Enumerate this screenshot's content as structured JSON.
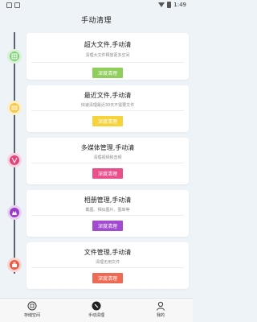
{
  "status_bar": {
    "time": "1:49"
  },
  "page_title": "手动清理",
  "items": [
    {
      "title": "超大文件,手动清",
      "subtitle": "清理大文件释放更多空间",
      "button": "深度清理",
      "button_color": "#8fce5a",
      "dot_color": "#7fcf7a",
      "icon": "grid-icon"
    },
    {
      "title": "最近文件,手动清",
      "subtitle": "快速清理最近30天不需要文件",
      "button": "深度清理",
      "button_color": "#f6d23b",
      "dot_color": "#f6c84a",
      "icon": "file-icon"
    },
    {
      "title": "多媒体管理,手动清",
      "subtitle": "清理视频和音频",
      "button": "深度清理",
      "button_color": "#ea4f8c",
      "dot_color": "#e2447a",
      "icon": "media-icon"
    },
    {
      "title": "相册管理,手动清",
      "subtitle": "截图、相似图片、图库等",
      "button": "深度清理",
      "button_color": "#a24bd0",
      "dot_color": "#9c3dc9",
      "icon": "photo-icon"
    },
    {
      "title": "文件管理,手动清",
      "subtitle": "清理无用文件",
      "button": "深度清理",
      "button_color": "#ef6a55",
      "dot_color": "#ec5c49",
      "icon": "folder-icon"
    }
  ],
  "tabs": [
    {
      "label": "存储空间",
      "icon": "storage-icon"
    },
    {
      "label": "手动清理",
      "icon": "broom-icon"
    },
    {
      "label": "我的",
      "icon": "profile-icon"
    }
  ]
}
